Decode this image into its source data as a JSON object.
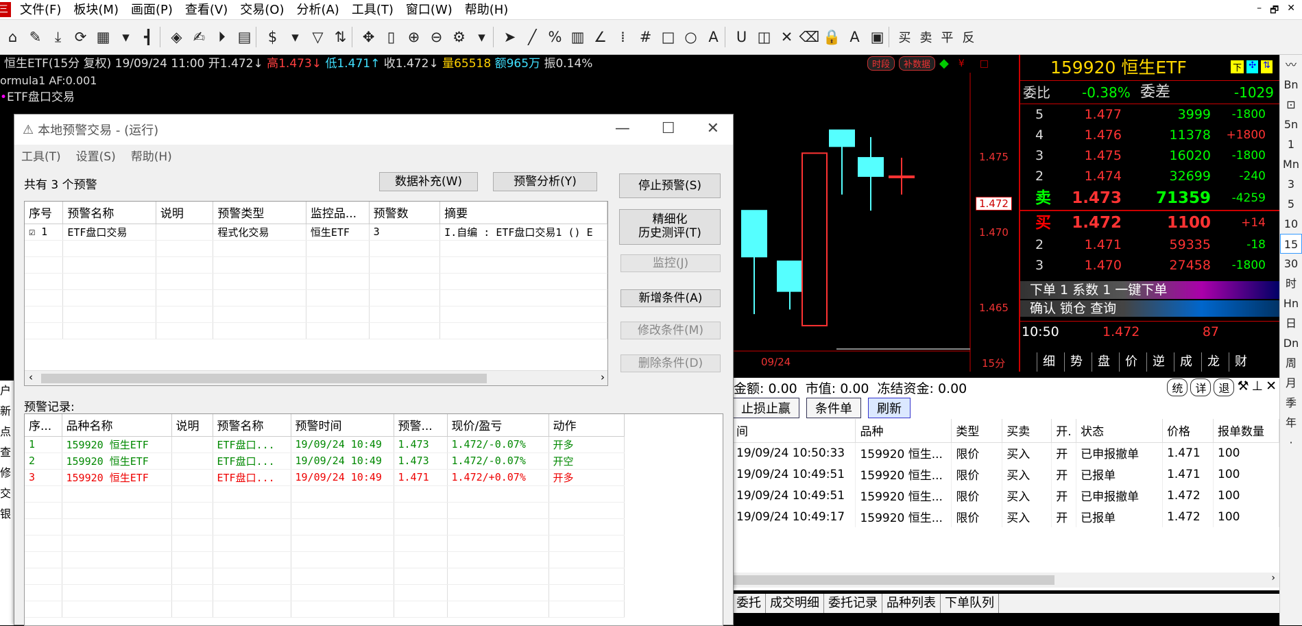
{
  "menubar": {
    "logo": "三",
    "items": [
      "文件(F)",
      "板块(M)",
      "画面(P)",
      "查看(V)",
      "交易(O)",
      "分析(A)",
      "工具(T)",
      "窗口(W)",
      "帮助(H)"
    ],
    "window_controls": [
      "–",
      "🗗",
      "✕"
    ]
  },
  "toolbar": {
    "icons": [
      "⌂",
      "✎",
      "⤓",
      "⟳",
      "▦",
      "▾",
      "┫",
      "◈",
      "✍",
      "⏵",
      "▤",
      "$",
      "▾",
      "▽",
      "⇅",
      "✥",
      "▯",
      "⊕",
      "⊖",
      "⚙",
      "▾",
      "➤",
      "╱",
      "%",
      "▥",
      "∠",
      "⁞",
      "#",
      "□",
      "○",
      "A",
      "U",
      "◫",
      "✕",
      "⌫",
      "🔒",
      "A",
      "▣"
    ],
    "text_buttons": [
      "买",
      "卖",
      "平",
      "反"
    ]
  },
  "chart": {
    "info_name": "恒生ETF(15分 复权)",
    "info_datetime": "19/09/24 11:00",
    "info_open": "开1.472",
    "info_high": "高1.473",
    "info_low": "低1.471",
    "info_close": "收1.472",
    "info_volume": "量65518",
    "info_amount": "额965万",
    "info_amplitude": "振0.14%",
    "formula": "ormula1 AF:0.001",
    "strategy": "ETF盘口交易",
    "badge_period": "时段",
    "badge_fill": "补数据",
    "price_labels": [
      "1.475",
      "1.472",
      "1.470",
      "1.465"
    ],
    "date_label": "09/24",
    "period_label": "15分",
    "candles": [
      {
        "open": 1.4715,
        "close": 1.4695,
        "high": 1.4715,
        "low": 1.467
      },
      {
        "open": 1.4693,
        "close": 1.468,
        "high": 1.4693,
        "low": 1.4672
      },
      {
        "open": 1.4665,
        "close": 1.474,
        "high": 1.474,
        "low": 1.4665
      },
      {
        "open": 1.475,
        "close": 1.4743,
        "high": 1.475,
        "low": 1.4722
      },
      {
        "open": 1.4738,
        "close": 1.473,
        "high": 1.4747,
        "low": 1.4715
      },
      {
        "open": 1.473,
        "close": 1.473,
        "high": 1.4738,
        "low": 1.4722
      }
    ]
  },
  "orderbook": {
    "title": "159920 恒生ETF",
    "wb_label": "委比",
    "wb_value": "-0.38%",
    "wc_label": "委差",
    "wc_value": "-1029",
    "asks": [
      {
        "level": "5",
        "price": "1.477",
        "vol": "3999",
        "chg": "-1800"
      },
      {
        "level": "4",
        "price": "1.476",
        "vol": "11378",
        "chg": "+1800"
      },
      {
        "level": "3",
        "price": "1.475",
        "vol": "16020",
        "chg": "-1800"
      },
      {
        "level": "2",
        "price": "1.474",
        "vol": "32699",
        "chg": "-240"
      },
      {
        "level": "卖",
        "price": "1.473",
        "vol": "71359",
        "chg": "-4259"
      }
    ],
    "bids": [
      {
        "level": "买",
        "price": "1.472",
        "vol": "1100",
        "chg": "+14"
      },
      {
        "level": "2",
        "price": "1.471",
        "vol": "59335",
        "chg": "-18"
      },
      {
        "level": "3",
        "price": "1.470",
        "vol": "27458",
        "chg": "-1800"
      }
    ],
    "order_row1": "下单 1  系数 1   一键下单",
    "order_row2": "确认  锁仓   查询",
    "tick_time": "10:50",
    "tick_price": "1.472",
    "tick_vol": "87",
    "tabs": [
      "细",
      "势",
      "盘",
      "价",
      "逆",
      "成",
      "龙",
      "财"
    ]
  },
  "right_sidebar": [
    "〰",
    "Bn",
    "⊡",
    "5n",
    "1",
    "Mn",
    "3",
    "5",
    "10",
    "15",
    "30",
    "时",
    "Hn",
    "日",
    "Dn",
    "周",
    "月",
    "季",
    "年",
    "·"
  ],
  "account": {
    "amount": "金额: 0.00",
    "market_value": "市值: 0.00",
    "frozen": "冻结资金: 0.00",
    "controls": [
      "统",
      "详",
      "退"
    ],
    "buttons": [
      "止损止赢",
      "条件单",
      "刷新"
    ],
    "columns": [
      "间",
      "品种",
      "类型",
      "买卖",
      "开.",
      "状态",
      "价格",
      "报单数量"
    ],
    "rows": [
      [
        "19/09/24 10:50:33",
        "159920 恒生...",
        "限价",
        "买入",
        "开",
        "已申报撤单",
        "1.471",
        "100"
      ],
      [
        "19/09/24 10:49:51",
        "159920 恒生...",
        "限价",
        "买入",
        "开",
        "已报单",
        "1.471",
        "100"
      ],
      [
        "19/09/24 10:49:51",
        "159920 恒生...",
        "限价",
        "买入",
        "开",
        "已申报撤单",
        "1.472",
        "100"
      ],
      [
        "19/09/24 10:49:17",
        "159920 恒生...",
        "限价",
        "买入",
        "开",
        "已报单",
        "1.472",
        "100"
      ]
    ],
    "bottom_tabs": [
      "委托",
      "成交明细",
      "委托记录",
      "品种列表",
      "下单队列"
    ]
  },
  "left_strip": [
    "户",
    "新",
    "点",
    "查",
    "修",
    "交",
    "银"
  ],
  "dialog": {
    "title": "本地预警交易 - (运行)",
    "menu": [
      "工具(T)",
      "设置(S)",
      "帮助(H)"
    ],
    "count_text": "共有 3 个预警",
    "btn_fill": "数据补充(W)",
    "btn_analysis": "预警分析(Y)",
    "btn_stop": "停止预警(S)",
    "btn_refine_l1": "精细化",
    "btn_refine_l2": "历史测评(T)",
    "btn_monitor": "监控(J)",
    "btn_add": "新增条件(A)",
    "btn_modify": "修改条件(M)",
    "btn_delete": "删除条件(D)",
    "alerts_columns": [
      "序号",
      "预警名称",
      "说明",
      "预警类型",
      "监控品...",
      "预警数",
      "摘要"
    ],
    "alerts_rows": [
      {
        "no": "1",
        "name": "ETF盘口交易",
        "desc": "",
        "type": "程式化交易",
        "target": "恒生ETF",
        "count": "3",
        "summary": "I.自编 : ETF盘口交易1 () E"
      }
    ],
    "records_label": "预警记录:",
    "records_columns": [
      "序...",
      "品种名称",
      "说明",
      "预警名称",
      "预警时间",
      "预警...",
      "现价/盈亏",
      "动作"
    ],
    "records_rows": [
      {
        "no": "1",
        "symbol": "159920 恒生ETF",
        "desc": "",
        "name": "ETF盘口...",
        "time": "19/09/24 10:49",
        "price": "1.473",
        "pnl": "1.472/-0.07%",
        "action": "开多",
        "color": "green"
      },
      {
        "no": "2",
        "symbol": "159920 恒生ETF",
        "desc": "",
        "name": "ETF盘口...",
        "time": "19/09/24 10:49",
        "price": "1.473",
        "pnl": "1.472/-0.07%",
        "action": "开空",
        "color": "green"
      },
      {
        "no": "3",
        "symbol": "159920 恒生ETF",
        "desc": "",
        "name": "ETF盘口...",
        "time": "19/09/24 10:49",
        "price": "1.471",
        "pnl": "1.472/+0.07%",
        "action": "开多",
        "color": "red"
      }
    ]
  }
}
